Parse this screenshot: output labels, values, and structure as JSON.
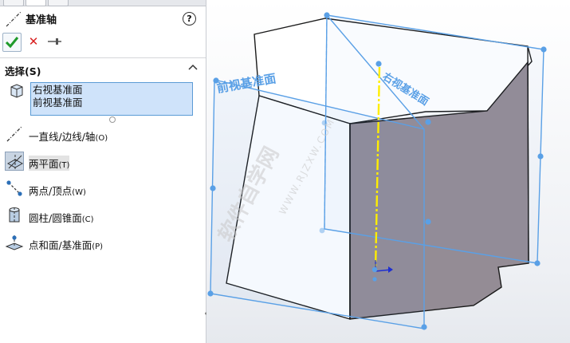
{
  "panel": {
    "title": "基准轴",
    "help_label": "?",
    "ok_icon": "checkmark-icon",
    "cancel_label": "✕",
    "pin_icon": "pushpin-icon",
    "section_title": "选择(S)",
    "selection_items": [
      "右视基准面",
      "前视基准面"
    ],
    "options": [
      {
        "name": "option-line-edge-axis",
        "label": "一直线/边线/轴",
        "shortcut": "(O)",
        "icon": "line-axis-icon",
        "active": false
      },
      {
        "name": "option-two-planes",
        "label": "两平面",
        "shortcut": "(T)",
        "icon": "two-planes-icon",
        "active": true
      },
      {
        "name": "option-two-points",
        "label": "两点/顶点",
        "shortcut": "(W)",
        "icon": "two-points-icon",
        "active": false
      },
      {
        "name": "option-cylinder-cone",
        "label": "圆柱/圆锥面",
        "shortcut": "(C)",
        "icon": "cylinder-icon",
        "active": false
      },
      {
        "name": "option-point-plane",
        "label": "点和面/基准面",
        "shortcut": "(P)",
        "icon": "point-plane-icon",
        "active": false
      }
    ]
  },
  "viewport": {
    "front_plane_label": "前视基准面",
    "right_plane_label": "右视基准面",
    "watermark_cn": "软件自学网",
    "watermark_url": "WWW.RJZXW.COM"
  },
  "colors": {
    "plane": "#5aa0e6",
    "axis": "#ffee00",
    "selection_bg": "#cfe3fa",
    "shaded_face": "#948c95"
  }
}
